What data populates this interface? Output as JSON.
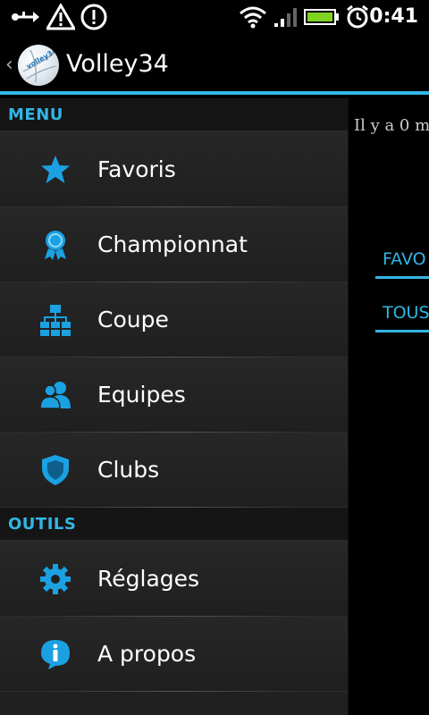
{
  "status_bar": {
    "time": "0:41",
    "icons": [
      "usb-icon",
      "warning-icon",
      "alert-icon",
      "wifi-icon",
      "signal-icon",
      "battery-icon",
      "alarm-icon"
    ]
  },
  "action_bar": {
    "title": "Volley34",
    "logo_text": "volley34"
  },
  "drawer": {
    "sections": [
      {
        "header": "MENU",
        "items": [
          {
            "label": "Favoris",
            "icon": "star-icon"
          },
          {
            "label": "Championnat",
            "icon": "medal-icon"
          },
          {
            "label": "Coupe",
            "icon": "bracket-icon"
          },
          {
            "label": "Equipes",
            "icon": "team-icon"
          },
          {
            "label": "Clubs",
            "icon": "shield-icon"
          }
        ]
      },
      {
        "header": "OUTILS",
        "items": [
          {
            "label": "Réglages",
            "icon": "gear-icon"
          },
          {
            "label": "A propos",
            "icon": "info-icon"
          }
        ]
      }
    ]
  },
  "background_content": {
    "text": "Il y a 0 m",
    "favorites_button": "FAVO",
    "all_button": "TOUS"
  },
  "colors": {
    "accent": "#33b5e5",
    "drawer_bg": "#202020",
    "header_bg": "#151515"
  }
}
